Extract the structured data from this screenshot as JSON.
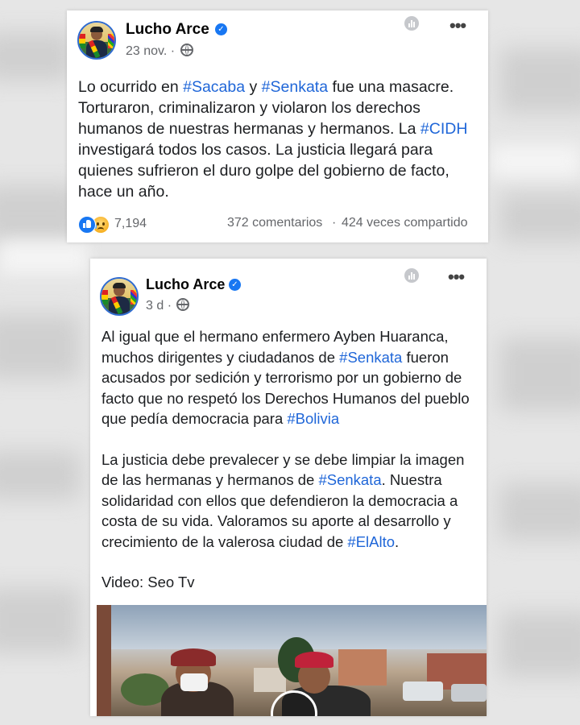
{
  "post1": {
    "author": "Lucho Arce",
    "date": "23 nov. ·",
    "text_parts": [
      "Lo ocurrido en ",
      "#Sacaba",
      " y ",
      "#Senkata",
      " fue una masacre. Torturaron, criminalizaron y violaron los derechos humanos de nuestras hermanas y hermanos. La ",
      "#CIDH",
      " investigará todos los casos. La justicia llegará para quienes sufrieron el duro golpe del gobierno de facto, hace un año."
    ],
    "reaction_count": "7,194",
    "comments": "372 comentarios",
    "separator": "·",
    "shares": "424 veces compartido"
  },
  "post2": {
    "author": "Lucho Arce",
    "date": "3 d ·",
    "p1_parts": [
      "Al igual que el hermano enfermero Ayben Huaranca, muchos dirigentes y ciudadanos de ",
      "#Senkata",
      " fueron acusados por sedición y terrorismo por un gobierno de facto que no respetó los Derechos Humanos del pueblo que pedía democracia para ",
      "#Bolivia"
    ],
    "p2_parts": [
      "La justicia debe prevalecer y se debe limpiar la imagen de las hermanas y hermanos de ",
      "#Senkata",
      ". Nuestra solidaridad con ellos que defendieron la democracia a costa de su vida. Valoramos su aporte al desarrollo y crecimiento de la valerosa ciudad de ",
      "#ElAlto",
      "."
    ],
    "p3": "Video: Seo Tv"
  },
  "icons": {
    "verified": "verified-badge-icon",
    "globe": "globe-icon",
    "insights": "insights-icon",
    "more": "more-options-icon",
    "like": "like-reaction-icon",
    "sad": "sad-reaction-icon",
    "play": "play-icon"
  },
  "colors": {
    "hashtag": "#1f66d8",
    "verified": "#1877f2",
    "meta": "#65676b",
    "text": "#1c1e21"
  }
}
